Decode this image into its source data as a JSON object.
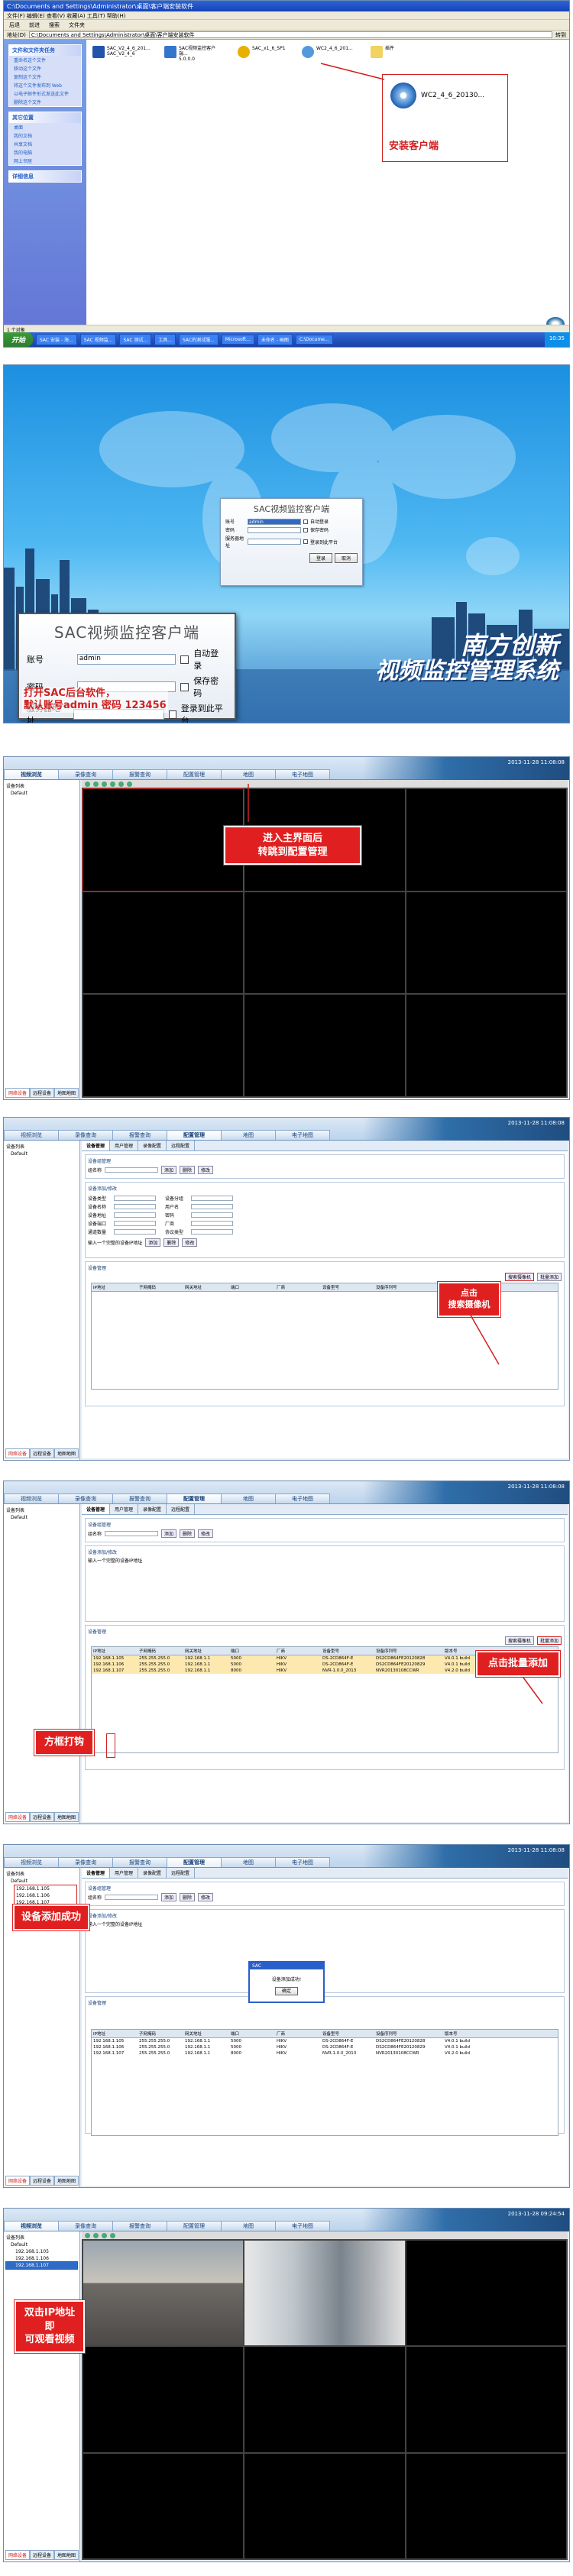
{
  "panel1": {
    "title": "C:\\Documents and Settings\\Administrator\\桌面\\客户端安装软件",
    "menu": "文件(F)  编辑(E)  查看(V)  收藏(A)  工具(T)  帮助(H)",
    "toolbar": [
      "后退",
      "前进",
      "搜索",
      "文件夹"
    ],
    "address_label": "地址(D)",
    "address": "C:\\Documents and Settings\\Administrator\\桌面\\客户端安装软件",
    "go": "转到",
    "side_task_title": "文件和文件夹任务",
    "side_task_items": [
      "重命名这个文件",
      "移动这个文件",
      "复制这个文件",
      "将这个文件发布到 Web",
      "以电子邮件形式发送此文件",
      "删除这个文件"
    ],
    "side_other_title": "其它位置",
    "side_other_items": [
      "桌面",
      "我的文档",
      "共享文档",
      "我的电脑",
      "网上邻居"
    ],
    "side_detail_title": "详细信息",
    "files": [
      {
        "name": "SAC_V2_4_6_201...",
        "sub": "SAC_V2_4_6",
        "color": "#2255aa"
      },
      {
        "name": "SAC视频监控客户端...",
        "sub": "5.0.0.0",
        "color": "#3377cc"
      },
      {
        "name": "SAC_x1_6_SP1",
        "sub": "",
        "color": "#e8b000"
      },
      {
        "name": "WC2_4_6_201...",
        "sub": "",
        "color": "#5599dd"
      },
      {
        "name": "插件",
        "sub": "",
        "color": "#f2d260"
      }
    ],
    "zoom_file": "WC2_4_6_20130...",
    "callout": "安装客户端",
    "status": "1 个对象",
    "start": "开始",
    "taskbar": [
      "SAC 安装 - 海...",
      "SAC 视频监...",
      "SAC 测试...",
      "工具...",
      "SAC的测试服...",
      "Microsoft...",
      "未命名 - 画图",
      "C:\\Docume..."
    ],
    "clock": "10:35"
  },
  "panel2": {
    "small_title": "SAC视频监控客户端",
    "account_label": "账号",
    "account_value": "admin",
    "password_label": "密码",
    "server_label": "服务器地址",
    "auto_login": "自动登录",
    "save_pwd": "保存密码",
    "login_platform": "登录到此平台",
    "login_btn": "登录",
    "cancel_btn": "取消",
    "big_title": "SAC视频监控客户端",
    "note": "打开SAC后台软件，\n默认账号admin  密码 123456",
    "brand1": "南方创新",
    "brand2": "视频监控管理系统"
  },
  "app": {
    "tabs": [
      "视频浏览",
      "录像查询",
      "报警查询",
      "配置管理",
      "地图",
      "电子地图"
    ],
    "datetime": "2013-11-28 11:08:08",
    "tree_root": "设备列表",
    "tree_group": "Default",
    "left_tabs": [
      "网络设备",
      "远程设备",
      "地图地图"
    ]
  },
  "panel3": {
    "callout": "进入主界面后\n转跳到配置管理"
  },
  "config": {
    "subtabs": [
      "设备管理",
      "用户管理",
      "录像配置",
      "远程配置",
      "远程配置"
    ],
    "group_title": "设备组管理",
    "group_name": "组名称",
    "add": "添加",
    "delete": "删除",
    "modify": "修改",
    "dev_title": "设备添加/修改",
    "dev_fields": [
      "设备类型",
      "设备名称",
      "设备地址",
      "设备端口",
      "通道数量"
    ],
    "ext_fields": [
      "设备分组",
      "用户名",
      "密码",
      "厂商",
      "协议类型"
    ],
    "dev_hint": "输入一个完整的设备IP地址",
    "mgr_title": "设备管理",
    "search_btn": "搜索摄像机",
    "batch_btn": "批量添加",
    "table_header": [
      "IP地址",
      "子网掩码",
      "网关地址",
      "端口",
      "厂商",
      "设备型号",
      "设备序列号",
      "版本号"
    ],
    "rows": [
      [
        "192.168.1.105",
        "255.255.255.0",
        "192.168.1.1",
        "5000",
        "HIKV",
        "DS-2CD864F-E",
        "DS2CD864FE20120828",
        "V4.0.1 build"
      ],
      [
        "192.168.1.106",
        "255.255.255.0",
        "192.168.1.1",
        "5000",
        "HIKV",
        "DS-2CD864F-E",
        "DS2CD864FE20120829",
        "V4.0.1 build"
      ],
      [
        "192.168.1.107",
        "255.255.255.0",
        "192.168.1.1",
        "8000",
        "HIKV",
        "NVR-1.0.0_2013",
        "NVR20130108CCWR",
        "V4.2.0 build"
      ]
    ]
  },
  "panel4": {
    "callout": "点击\n搜索摄像机"
  },
  "panel5": {
    "callout_batch": "点击批量添加",
    "callout_check": "方框打钩"
  },
  "panel6": {
    "callout": "设备添加成功",
    "dialog_title": "SAC",
    "dialog_text": "设备添加成功!",
    "dialog_ok": "确定",
    "tree_items": [
      "192.168.1.105",
      "192.168.1.106",
      "192.168.1.107"
    ]
  },
  "panel7": {
    "callout": "双击IP地址即\n可观看视频",
    "datetime": "2013-11-28 09:24:54",
    "tree_items": [
      "192.168.1.105",
      "192.168.1.106",
      "192.168.1.107"
    ]
  }
}
